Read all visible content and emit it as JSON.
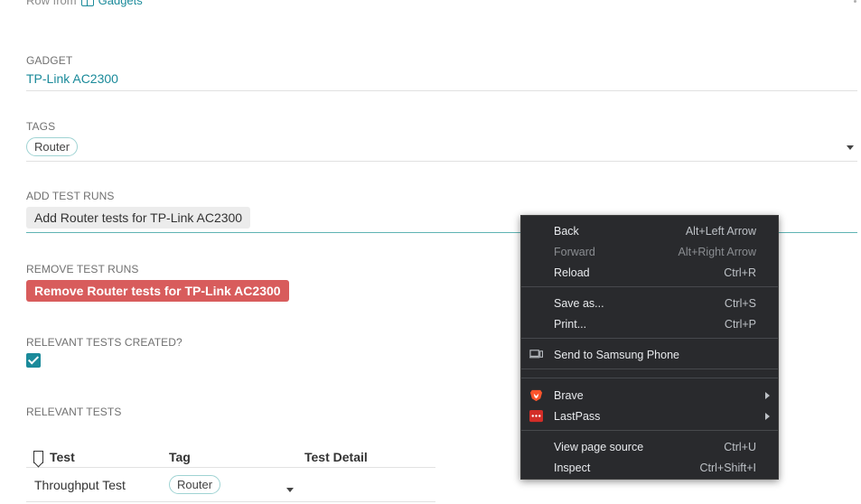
{
  "header": {
    "row_from": "Row from",
    "table_name": "Gadgets"
  },
  "fields": {
    "gadget": {
      "label": "GADGET",
      "value": "TP-Link AC2300"
    },
    "tags": {
      "label": "TAGS",
      "items": [
        "Router"
      ]
    },
    "add_test_runs": {
      "label": "ADD TEST RUNS",
      "button": "Add Router tests for TP-Link AC2300"
    },
    "remove_test_runs": {
      "label": "REMOVE TEST RUNS",
      "button": "Remove Router tests for TP-Link AC2300"
    },
    "relevant_tests_created": {
      "label": "RELEVANT TESTS CREATED?",
      "checked": true
    },
    "relevant_tests": {
      "label": "RELEVANT TESTS"
    }
  },
  "tests_table": {
    "columns": [
      "Test",
      "Tag",
      "Test Detail"
    ],
    "rows": [
      {
        "test": "Throughput Test",
        "tag": "Router",
        "detail": ""
      }
    ]
  },
  "context_menu": {
    "items": [
      {
        "label": "Back",
        "shortcut": "Alt+Left Arrow"
      },
      {
        "label": "Forward",
        "shortcut": "Alt+Right Arrow",
        "disabled": true
      },
      {
        "label": "Reload",
        "shortcut": "Ctrl+R"
      },
      {
        "label": "Save as...",
        "shortcut": "Ctrl+S"
      },
      {
        "label": "Print...",
        "shortcut": "Ctrl+P"
      },
      {
        "label": "Send to Samsung Phone",
        "icon": "device-icon"
      },
      {
        "label": "Brave",
        "icon": "brave-icon",
        "submenu": true
      },
      {
        "label": "LastPass",
        "icon": "lastpass-icon",
        "submenu": true
      },
      {
        "label": "View page source",
        "shortcut": "Ctrl+U"
      },
      {
        "label": "Inspect",
        "shortcut": "Ctrl+Shift+I"
      }
    ]
  },
  "colors": {
    "accent": "#1a8a9a",
    "danger": "#d85c5c",
    "menu_bg": "#292a2d"
  }
}
